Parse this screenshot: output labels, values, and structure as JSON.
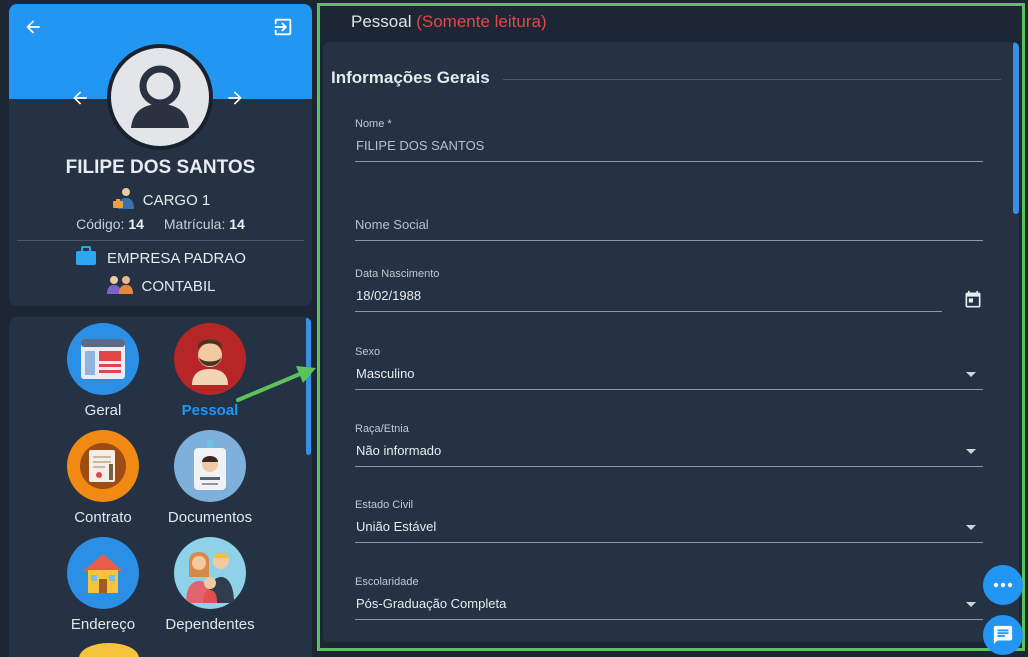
{
  "profile": {
    "name": "FILIPE DOS SANTOS",
    "cargo": "CARGO 1",
    "codigo_label": "Código:",
    "codigo_value": "14",
    "matricula_label": "Matrícula:",
    "matricula_value": "14",
    "company": "EMPRESA PADRAO",
    "department": "CONTABIL"
  },
  "menu": {
    "items": [
      {
        "label": "Geral",
        "icon": "general-info-icon"
      },
      {
        "label": "Pessoal",
        "icon": "person-icon",
        "active": true
      },
      {
        "label": "Contrato",
        "icon": "contract-icon"
      },
      {
        "label": "Documentos",
        "icon": "id-badge-icon"
      },
      {
        "label": "Endereço",
        "icon": "house-icon"
      },
      {
        "label": "Dependentes",
        "icon": "family-icon"
      }
    ]
  },
  "section": {
    "title": "Pessoal",
    "readonly_tag": "(Somente leitura)"
  },
  "form": {
    "group_title": "Informações Gerais",
    "nome": {
      "label": "Nome *",
      "value": "FILIPE DOS SANTOS"
    },
    "nome_social": {
      "placeholder": "Nome Social"
    },
    "data_nascimento": {
      "label": "Data Nascimento",
      "value": "18/02/1988"
    },
    "sexo": {
      "label": "Sexo",
      "value": "Masculino"
    },
    "raca": {
      "label": "Raça/Etnia",
      "value": "Não informado"
    },
    "estado_civil": {
      "label": "Estado Civil",
      "value": "União Estável"
    },
    "escolaridade": {
      "label": "Escolaridade",
      "value": "Pós-Graduação Completa"
    }
  },
  "colors": {
    "accent": "#2196f3",
    "readonly": "#e6454a",
    "highlight": "#5cc35c",
    "panel": "#243244",
    "background": "#1d2634"
  }
}
